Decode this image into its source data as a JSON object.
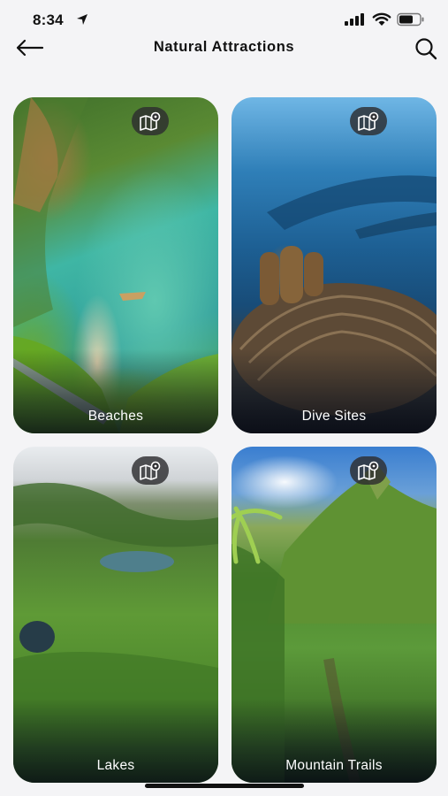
{
  "status": {
    "time": "8:34"
  },
  "nav": {
    "title": "Natural Attractions",
    "back_icon": "arrow-left-icon",
    "search_icon": "search-icon"
  },
  "cards": [
    {
      "label": "Beaches",
      "icon": "map-pin-icon"
    },
    {
      "label": "Dive Sites",
      "icon": "map-pin-icon"
    },
    {
      "label": "Lakes",
      "icon": "map-pin-icon"
    },
    {
      "label": "Mountain Trails",
      "icon": "map-pin-icon"
    }
  ],
  "colors": {
    "background": "#f4f4f6",
    "text": "#111111",
    "label_text": "#ffffff",
    "map_button_bg": "#2d2d30"
  }
}
